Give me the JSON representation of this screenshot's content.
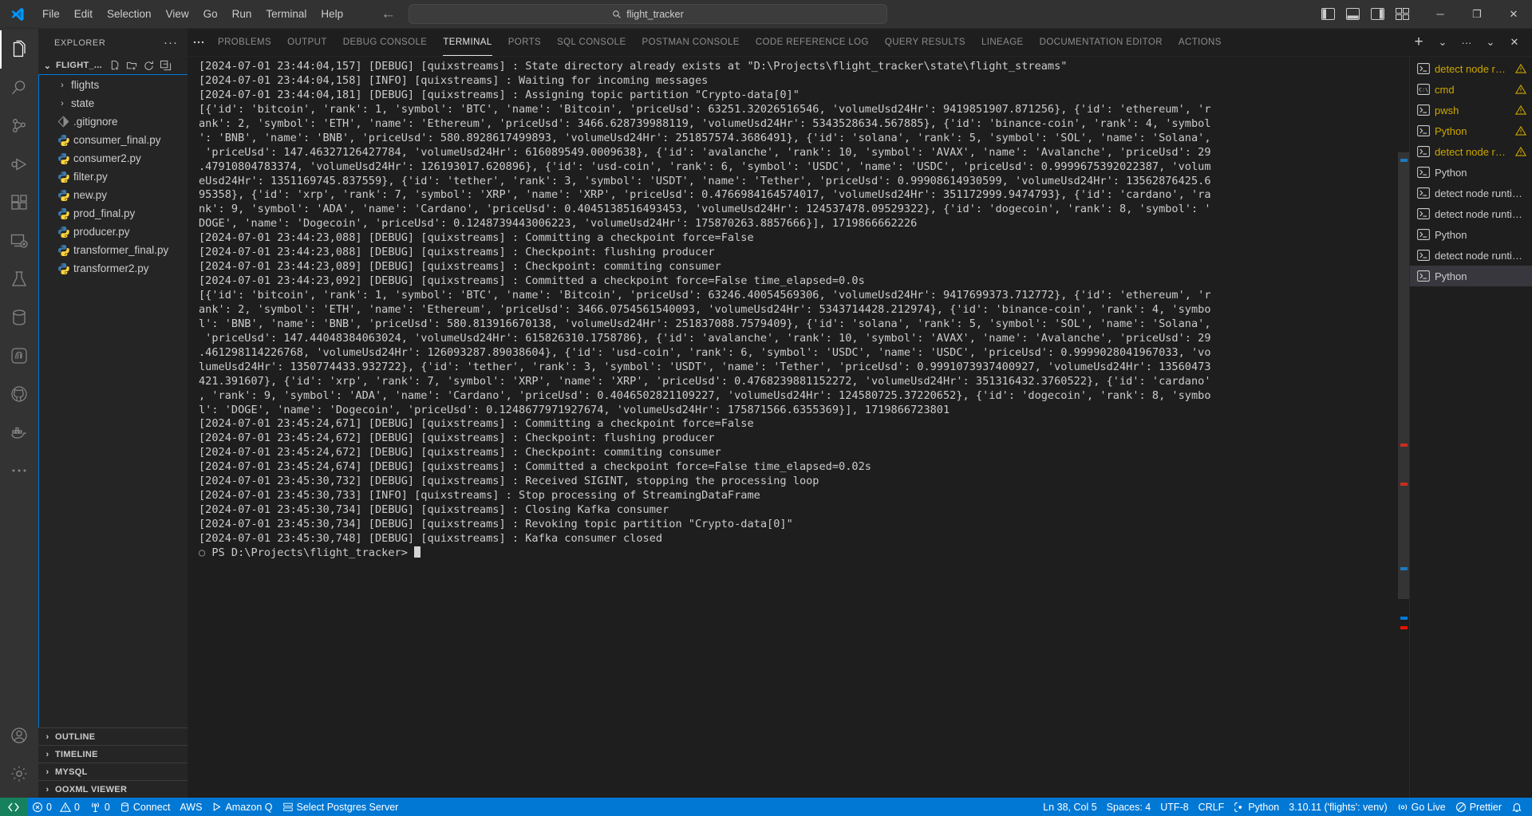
{
  "titlebar": {
    "menus": [
      "File",
      "Edit",
      "Selection",
      "View",
      "Go",
      "Run",
      "Terminal",
      "Help"
    ],
    "nav_back": "←",
    "nav_forward": "→",
    "command_center": "flight_tracker",
    "search_icon": "search-icon",
    "window_minimize": "─",
    "window_maximize": "❐",
    "window_close": "✕"
  },
  "activitybar": {
    "items": [
      {
        "name": "explorer",
        "active": true
      },
      {
        "name": "search",
        "active": false
      },
      {
        "name": "source-control",
        "active": false
      },
      {
        "name": "run-and-debug",
        "active": false
      },
      {
        "name": "extensions",
        "active": false
      },
      {
        "name": "remote-explorer",
        "active": false
      },
      {
        "name": "testing",
        "active": false
      },
      {
        "name": "database",
        "active": false
      },
      {
        "name": "postgres",
        "active": false
      },
      {
        "name": "github",
        "active": false
      },
      {
        "name": "docker",
        "active": false
      },
      {
        "name": "more",
        "active": false
      }
    ],
    "bottom": [
      {
        "name": "accounts"
      },
      {
        "name": "settings"
      }
    ]
  },
  "sidebar": {
    "title": "EXPLORER",
    "more_actions": "···",
    "folder": {
      "name": "FLIGHT_...",
      "expanded_chevron": "⌄",
      "actions": [
        "new-file",
        "new-folder",
        "refresh",
        "collapse-all"
      ]
    },
    "tree": [
      {
        "label": "flights",
        "type": "folder",
        "chevron": "›"
      },
      {
        "label": "state",
        "type": "folder",
        "chevron": "›"
      },
      {
        "label": ".gitignore",
        "type": "git"
      },
      {
        "label": "consumer_final.py",
        "type": "python"
      },
      {
        "label": "consumer2.py",
        "type": "python"
      },
      {
        "label": "filter.py",
        "type": "python"
      },
      {
        "label": "new.py",
        "type": "python"
      },
      {
        "label": "prod_final.py",
        "type": "python"
      },
      {
        "label": "producer.py",
        "type": "python"
      },
      {
        "label": "transformer_final.py",
        "type": "python"
      },
      {
        "label": "transformer2.py",
        "type": "python"
      }
    ],
    "sections": [
      {
        "label": "OUTLINE",
        "chevron": "›"
      },
      {
        "label": "TIMELINE",
        "chevron": "›"
      },
      {
        "label": "MYSQL",
        "chevron": "›"
      },
      {
        "label": "OOXML VIEWER",
        "chevron": "›"
      }
    ]
  },
  "panel": {
    "more_icon": "···",
    "tabs": [
      {
        "label": "PROBLEMS",
        "active": false
      },
      {
        "label": "OUTPUT",
        "active": false
      },
      {
        "label": "DEBUG CONSOLE",
        "active": false
      },
      {
        "label": "TERMINAL",
        "active": true
      },
      {
        "label": "PORTS",
        "active": false
      },
      {
        "label": "SQL CONSOLE",
        "active": false
      },
      {
        "label": "POSTMAN CONSOLE",
        "active": false
      },
      {
        "label": "CODE REFERENCE LOG",
        "active": false
      },
      {
        "label": "QUERY RESULTS",
        "active": false
      },
      {
        "label": "LINEAGE",
        "active": false
      },
      {
        "label": "DOCUMENTATION EDITOR",
        "active": false
      },
      {
        "label": "ACTIONS",
        "active": false
      }
    ],
    "actions": [
      {
        "name": "new-terminal-button",
        "glyph": "+"
      },
      {
        "name": "terminal-profile-chevron",
        "glyph": "⌄"
      },
      {
        "name": "panel-more-actions-button",
        "glyph": "···"
      },
      {
        "name": "panel-maximize-chevron",
        "glyph": "⌄"
      },
      {
        "name": "panel-close-button",
        "glyph": "✕"
      }
    ]
  },
  "terminal": {
    "lines": [
      "[2024-07-01 23:44:04,157] [DEBUG] [quixstreams] : State directory already exists at \"D:\\Projects\\flight_tracker\\state\\flight_streams\"",
      "[2024-07-01 23:44:04,158] [INFO] [quixstreams] : Waiting for incoming messages",
      "[2024-07-01 23:44:04,181] [DEBUG] [quixstreams] : Assigning topic partition \"Crypto-data[0]\"",
      "[{'id': 'bitcoin', 'rank': 1, 'symbol': 'BTC', 'name': 'Bitcoin', 'priceUsd': 63251.32026516546, 'volumeUsd24Hr': 9419851907.871256}, {'id': 'ethereum', 'r",
      "ank': 2, 'symbol': 'ETH', 'name': 'Ethereum', 'priceUsd': 3466.628739988119, 'volumeUsd24Hr': 5343528634.567885}, {'id': 'binance-coin', 'rank': 4, 'symbol",
      "': 'BNB', 'name': 'BNB', 'priceUsd': 580.8928617499893, 'volumeUsd24Hr': 251857574.3686491}, {'id': 'solana', 'rank': 5, 'symbol': 'SOL', 'name': 'Solana',",
      " 'priceUsd': 147.46327126427784, 'volumeUsd24Hr': 616089549.0009638}, {'id': 'avalanche', 'rank': 10, 'symbol': 'AVAX', 'name': 'Avalanche', 'priceUsd': 29",
      ".47910804783374, 'volumeUsd24Hr': 126193017.620896}, {'id': 'usd-coin', 'rank': 6, 'symbol': 'USDC', 'name': 'USDC', 'priceUsd': 0.9999675392022387, 'volum",
      "eUsd24Hr': 1351169745.837559}, {'id': 'tether', 'rank': 3, 'symbol': 'USDT', 'name': 'Tether', 'priceUsd': 0.99908614930599, 'volumeUsd24Hr': 13562876425.6",
      "95358}, {'id': 'xrp', 'rank': 7, 'symbol': 'XRP', 'name': 'XRP', 'priceUsd': 0.4766984164574017, 'volumeUsd24Hr': 351172999.9474793}, {'id': 'cardano', 'ra",
      "nk': 9, 'symbol': 'ADA', 'name': 'Cardano', 'priceUsd': 0.4045138516493453, 'volumeUsd24Hr': 124537478.09529322}, {'id': 'dogecoin', 'rank': 8, 'symbol': '",
      "DOGE', 'name': 'Dogecoin', 'priceUsd': 0.1248739443006223, 'volumeUsd24Hr': 175870263.8857666}], 1719866662226",
      "[2024-07-01 23:44:23,088] [DEBUG] [quixstreams] : Committing a checkpoint force=False",
      "[2024-07-01 23:44:23,088] [DEBUG] [quixstreams] : Checkpoint: flushing producer",
      "[2024-07-01 23:44:23,089] [DEBUG] [quixstreams] : Checkpoint: commiting consumer",
      "[2024-07-01 23:44:23,092] [DEBUG] [quixstreams] : Committed a checkpoint force=False time_elapsed=0.0s",
      "[{'id': 'bitcoin', 'rank': 1, 'symbol': 'BTC', 'name': 'Bitcoin', 'priceUsd': 63246.40054569306, 'volumeUsd24Hr': 9417699373.712772}, {'id': 'ethereum', 'r",
      "ank': 2, 'symbol': 'ETH', 'name': 'Ethereum', 'priceUsd': 3466.0754561540093, 'volumeUsd24Hr': 5343714428.212974}, {'id': 'binance-coin', 'rank': 4, 'symbo",
      "l': 'BNB', 'name': 'BNB', 'priceUsd': 580.813916670138, 'volumeUsd24Hr': 251837088.7579409}, {'id': 'solana', 'rank': 5, 'symbol': 'SOL', 'name': 'Solana',",
      " 'priceUsd': 147.44048384063024, 'volumeUsd24Hr': 615826310.1758786}, {'id': 'avalanche', 'rank': 10, 'symbol': 'AVAX', 'name': 'Avalanche', 'priceUsd': 29",
      ".461298114226768, 'volumeUsd24Hr': 126093287.89038604}, {'id': 'usd-coin', 'rank': 6, 'symbol': 'USDC', 'name': 'USDC', 'priceUsd': 0.9999028041967033, 'vo",
      "lumeUsd24Hr': 1350774433.932722}, {'id': 'tether', 'rank': 3, 'symbol': 'USDT', 'name': 'Tether', 'priceUsd': 0.9991073937400927, 'volumeUsd24Hr': 13560473",
      "421.391607}, {'id': 'xrp', 'rank': 7, 'symbol': 'XRP', 'name': 'XRP', 'priceUsd': 0.4768239881152272, 'volumeUsd24Hr': 351316432.3760522}, {'id': 'cardano'",
      ", 'rank': 9, 'symbol': 'ADA', 'name': 'Cardano', 'priceUsd': 0.4046502821109227, 'volumeUsd24Hr': 124580725.37220652}, {'id': 'dogecoin', 'rank': 8, 'symbo",
      "l': 'DOGE', 'name': 'Dogecoin', 'priceUsd': 0.1248677971927674, 'volumeUsd24Hr': 175871566.6355369}], 1719866723801",
      "[2024-07-01 23:45:24,671] [DEBUG] [quixstreams] : Committing a checkpoint force=False",
      "[2024-07-01 23:45:24,672] [DEBUG] [quixstreams] : Checkpoint: flushing producer",
      "[2024-07-01 23:45:24,672] [DEBUG] [quixstreams] : Checkpoint: commiting consumer",
      "[2024-07-01 23:45:24,674] [DEBUG] [quixstreams] : Committed a checkpoint force=False time_elapsed=0.02s",
      "[2024-07-01 23:45:30,732] [DEBUG] [quixstreams] : Received SIGINT, stopping the processing loop",
      "[2024-07-01 23:45:30,733] [INFO] [quixstreams] : Stop processing of StreamingDataFrame",
      "[2024-07-01 23:45:30,734] [DEBUG] [quixstreams] : Closing Kafka consumer",
      "[2024-07-01 23:45:30,734] [DEBUG] [quixstreams] : Revoking topic partition \"Crypto-data[0]\"",
      "[2024-07-01 23:45:30,748] [DEBUG] [quixstreams] : Kafka consumer closed"
    ],
    "prompt": "PS D:\\Projects\\flight_tracker>"
  },
  "terminal_tabs": [
    {
      "label": "detect node r…",
      "icon": "pwsh",
      "warn": true,
      "active": false
    },
    {
      "label": "cmd",
      "icon": "cmd",
      "warn": true,
      "active": false
    },
    {
      "label": "pwsh",
      "icon": "pwsh",
      "warn": true,
      "active": false
    },
    {
      "label": "Python",
      "icon": "pwsh",
      "warn": true,
      "active": false
    },
    {
      "label": "detect node r…",
      "icon": "pwsh",
      "warn": true,
      "active": false
    },
    {
      "label": "Python",
      "icon": "pwsh",
      "warn": false,
      "active": false
    },
    {
      "label": "detect node runti…",
      "icon": "pwsh",
      "warn": false,
      "active": false
    },
    {
      "label": "detect node runti…",
      "icon": "pwsh",
      "warn": false,
      "active": false
    },
    {
      "label": "Python",
      "icon": "pwsh",
      "warn": false,
      "active": false
    },
    {
      "label": "detect node runti…",
      "icon": "pwsh",
      "warn": false,
      "active": false
    },
    {
      "label": "Python",
      "icon": "pwsh",
      "warn": false,
      "active": true
    }
  ],
  "statusbar": {
    "remote_icon": "remote-window-icon",
    "left": [
      {
        "name": "errors-warnings",
        "icon": "error-icon",
        "label": "0",
        "icon2": "warning-icon",
        "label2": "0"
      },
      {
        "name": "radio-tower",
        "icon": "radio-tower-icon",
        "label": "0"
      },
      {
        "name": "connect",
        "icon": "database-icon",
        "label": "Connect"
      },
      {
        "name": "aws",
        "icon": "",
        "label": "AWS"
      },
      {
        "name": "amazon-q",
        "icon": "play-icon",
        "label": "Amazon Q"
      },
      {
        "name": "select-postgres-server",
        "icon": "server-icon",
        "label": "Select Postgres Server"
      }
    ],
    "right": [
      {
        "name": "cursor-position",
        "label": "Ln 38, Col 5"
      },
      {
        "name": "indentation",
        "label": "Spaces: 4"
      },
      {
        "name": "encoding",
        "label": "UTF-8"
      },
      {
        "name": "eol",
        "label": "CRLF"
      },
      {
        "name": "language-mode",
        "label": "Python",
        "icon": "python-icon"
      },
      {
        "name": "python-interpreter",
        "label": "3.10.11 ('flights': venv)"
      },
      {
        "name": "go-live",
        "label": "Go Live",
        "icon": "broadcast-icon"
      },
      {
        "name": "prettier",
        "label": "Prettier",
        "icon": "prettier-icon"
      },
      {
        "name": "notifications",
        "label": "",
        "icon": "bell-icon"
      }
    ]
  },
  "colors": {
    "accent": "#0078d4",
    "remote_green": "#16825d",
    "warning": "#cca700",
    "titlebar_bg": "#323233",
    "sidebar_bg": "#252526",
    "editor_bg": "#1e1e1e",
    "activitybar_bg": "#333333",
    "python_blue": "#4b8bbe",
    "python_yellow": "#ffd43b"
  }
}
